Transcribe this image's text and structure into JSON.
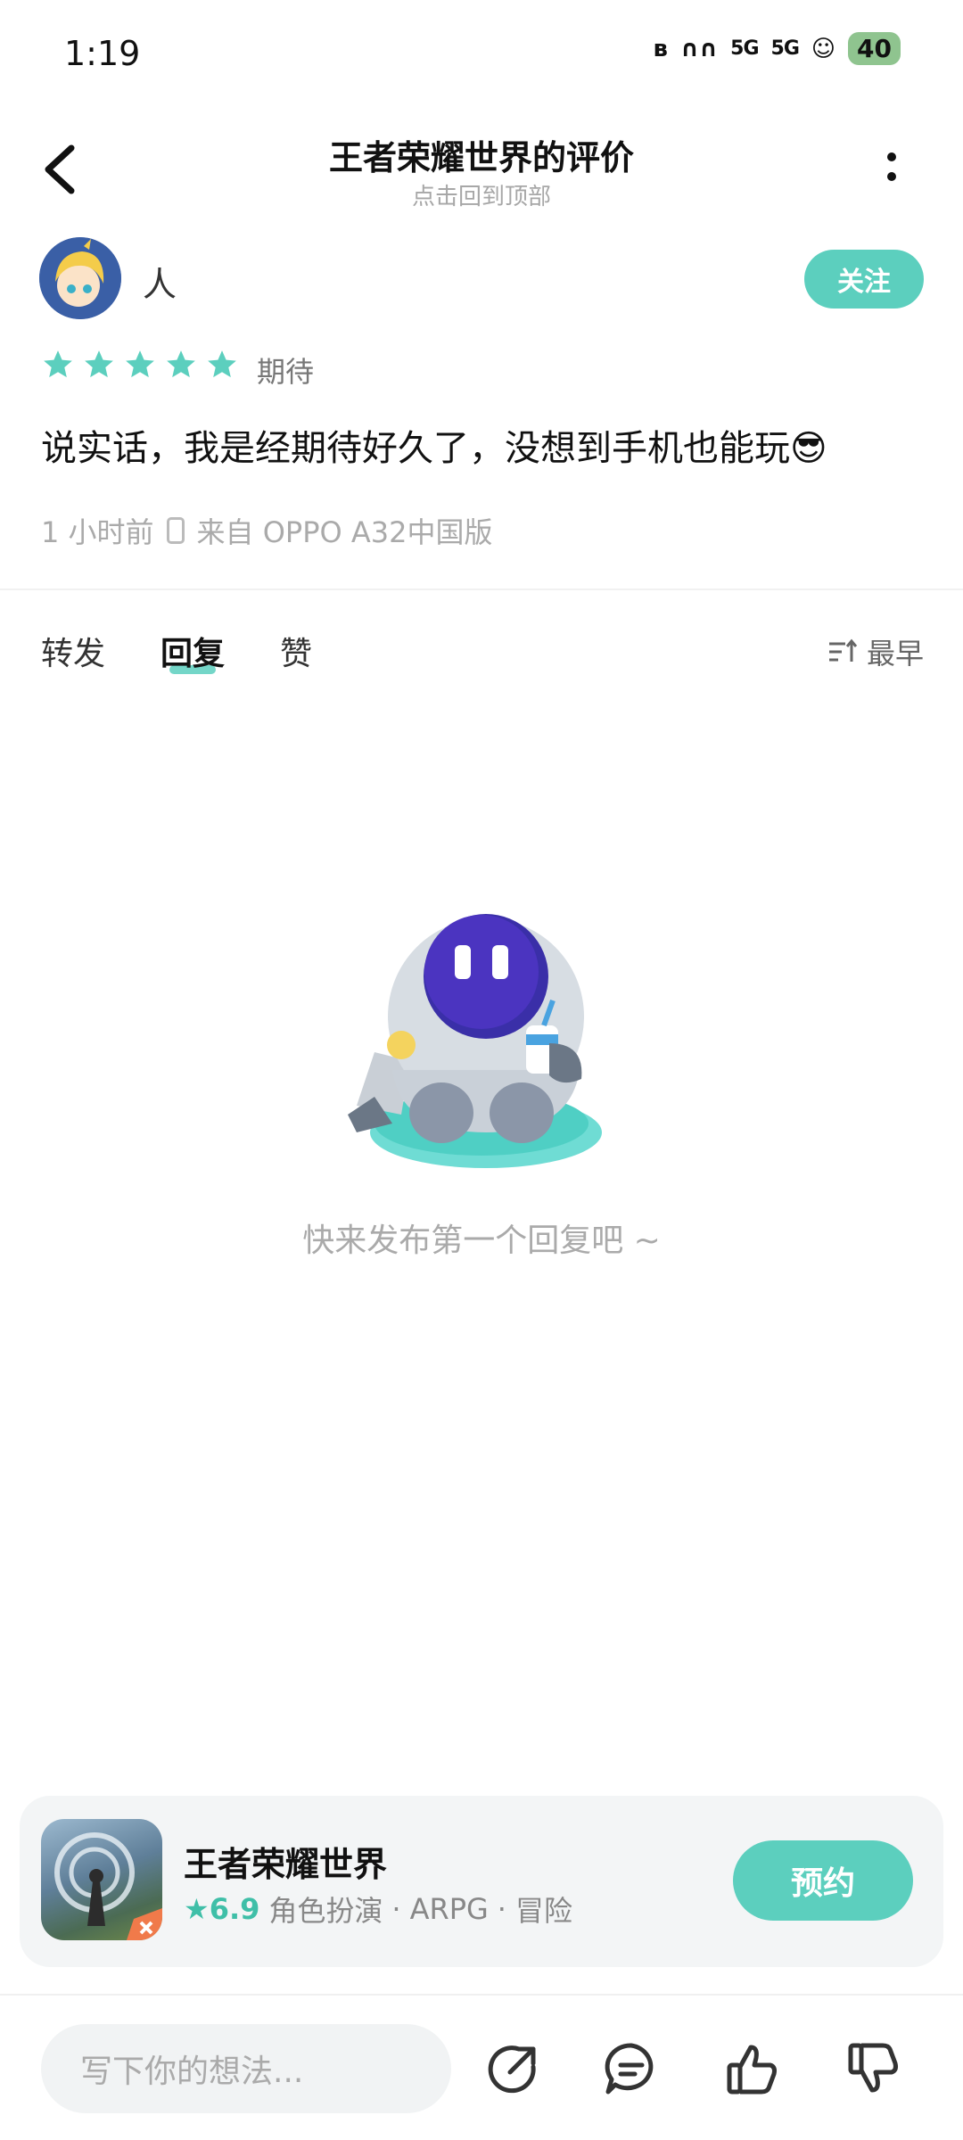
{
  "status_bar": {
    "time": "1:19",
    "signal_1": "5G",
    "signal_2": "5G",
    "battery": "40"
  },
  "header": {
    "title": "王者荣耀世界的评价",
    "subtitle": "点击回到顶部"
  },
  "review": {
    "username": "人",
    "follow_label": "关注",
    "rating_stars": 5,
    "rating_label": "期待",
    "text": "说实话，我是经期待好久了，没想到手机也能玩😎",
    "time": "1 小时前",
    "device": "来自 OPPO A32中国版"
  },
  "tabs": [
    {
      "label": "转发"
    },
    {
      "label": "回复"
    },
    {
      "label": "赞"
    }
  ],
  "sort_label": "最早",
  "empty_state": {
    "text": "快来发布第一个回复吧 ~"
  },
  "app_card": {
    "name": "王者荣耀世界",
    "score": "6.9",
    "tags": [
      "角色扮演",
      "ARPG",
      "冒险"
    ],
    "button_label": "预约"
  },
  "bottom_bar": {
    "input_placeholder": "写下你的想法..."
  },
  "colors": {
    "accent": "#5ccfbe",
    "score": "#3fbfa8"
  }
}
